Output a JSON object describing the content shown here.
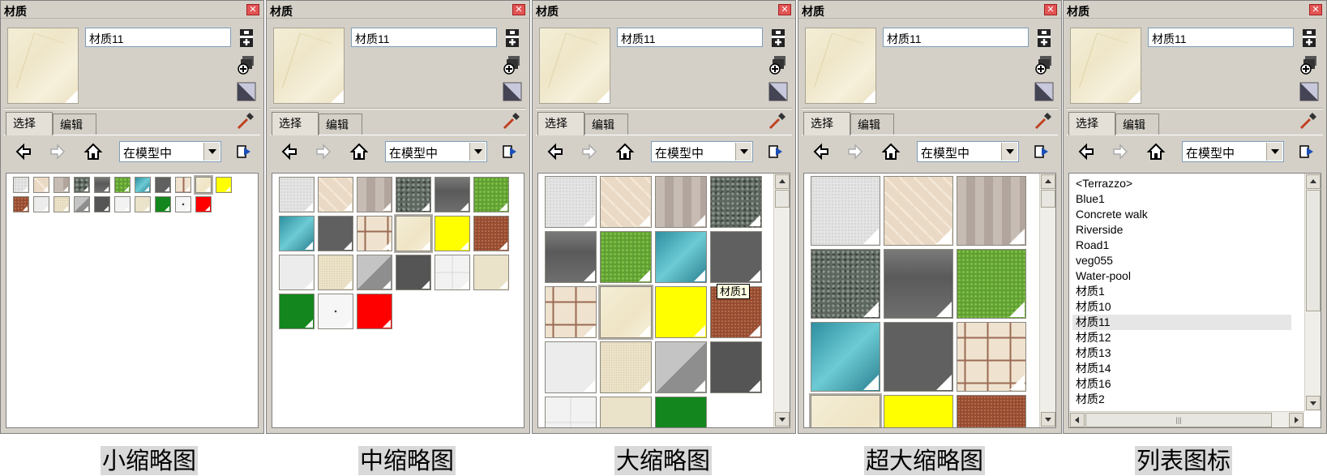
{
  "panel_title": "材质",
  "close_label": "✕",
  "material_name": "材质11",
  "tabs": {
    "select": "选择",
    "edit": "编辑"
  },
  "collection": "在模型中",
  "tooltip": "材质1",
  "list_items": [
    "<Terrazzo>",
    "Blue1",
    "Concrete walk",
    "Riverside",
    "Road1",
    "veg055",
    "Water-pool",
    "材质1",
    "材质10",
    "材质11",
    "材质12",
    "材质13",
    "材质14",
    "材质16",
    "材质2"
  ],
  "selected_list_item": "材质11",
  "captions": [
    "小缩略图",
    "中缩略图",
    "大缩略图",
    "超大缩略图",
    "列表图标"
  ],
  "icons": {
    "create": "create-material-icon",
    "detail": "details-arrow-icon",
    "default": "default-material-icon",
    "sample": "eyedropper-icon",
    "back": "back-arrow-icon",
    "forward": "forward-arrow-icon",
    "home": "home-icon",
    "details": "details-icon"
  },
  "colors": {
    "accent_red": "#e35454",
    "selection": "#e6e6e6",
    "panel_bg": "#d4d0c8"
  }
}
